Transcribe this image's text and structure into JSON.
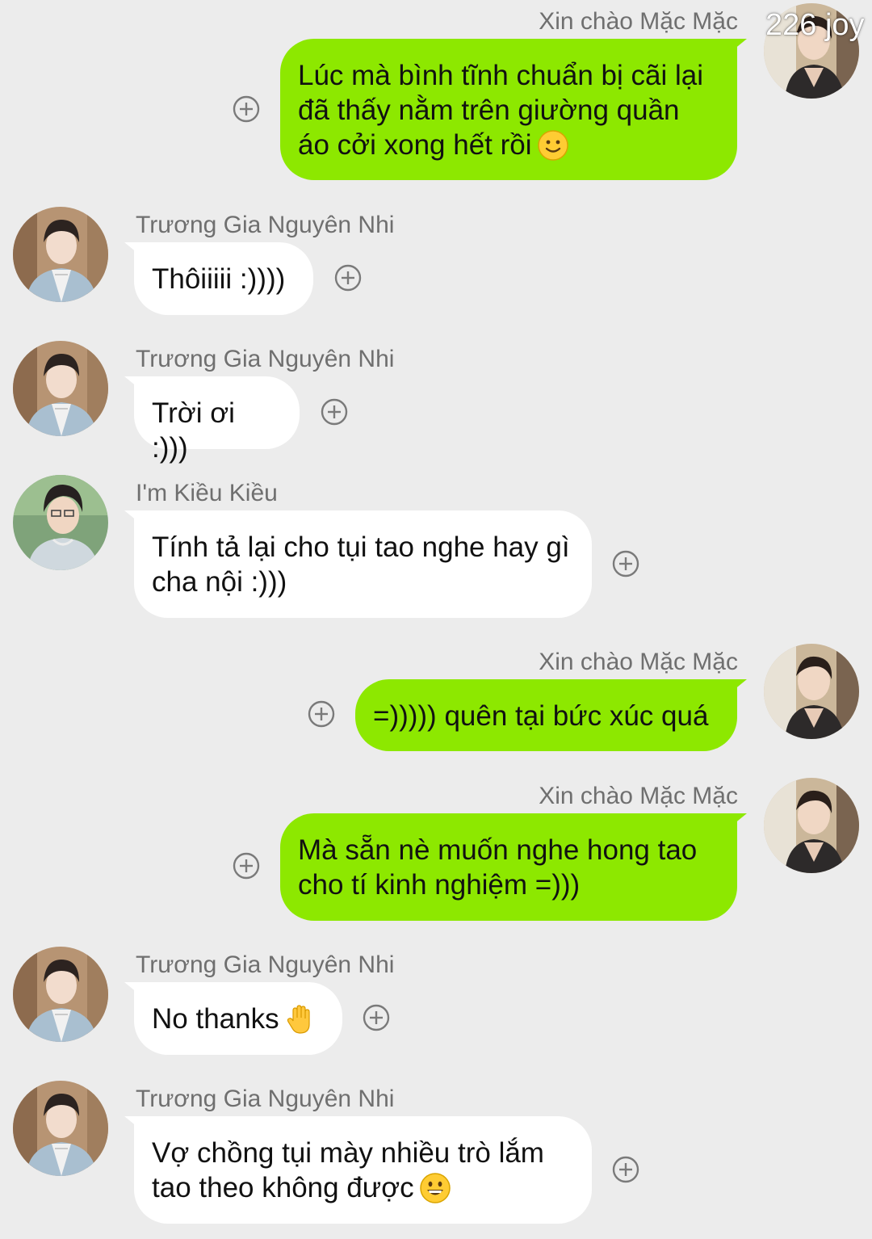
{
  "watermark": "226 joy",
  "messages": [
    {
      "sender": "Xin chào Mặc Mặc",
      "text": "Lúc mà bình tĩnh chuẩn bị cãi lại đã thấy nằm trên giường quần áo cởi xong hết rồi",
      "emoji": "slightly-smiling-face",
      "direction": "out",
      "avatar": "avatar-mac-mac"
    },
    {
      "sender": "Trương Gia Nguyên Nhi",
      "text": "Thôiiiii :))))",
      "direction": "in",
      "avatar": "avatar-nguyen-nhi"
    },
    {
      "sender": "Trương Gia Nguyên Nhi",
      "text": "Trời ơi :)))",
      "direction": "in",
      "avatar": "avatar-nguyen-nhi"
    },
    {
      "sender": "I'm Kiều Kiều",
      "text": "Tính tả lại cho tụi tao nghe hay gì cha nội :)))",
      "direction": "in",
      "avatar": "avatar-kieu-kieu"
    },
    {
      "sender": "Xin chào Mặc Mặc",
      "text": "=))))) quên tại bức xúc quá",
      "direction": "out",
      "avatar": "avatar-mac-mac"
    },
    {
      "sender": "Xin chào Mặc Mặc",
      "text": "Mà sẵn nè muốn nghe hong tao cho tí kinh nghiệm =)))",
      "direction": "out",
      "avatar": "avatar-mac-mac"
    },
    {
      "sender": "Trương Gia Nguyên Nhi",
      "text": "No thanks",
      "emoji": "raised-hand",
      "direction": "in",
      "avatar": "avatar-nguyen-nhi"
    },
    {
      "sender": "Trương Gia Nguyên Nhi",
      "text": "Vợ chồng tụi mày nhiều trò lắm tao theo không được",
      "emoji": "grinning-face",
      "direction": "in",
      "avatar": "avatar-nguyen-nhi"
    }
  ],
  "colors": {
    "background": "#ececec",
    "outgoing_bubble": "#8de800",
    "incoming_bubble": "#ffffff",
    "sender_name": "#6f6f6f"
  },
  "icons": {
    "reaction_button": "plus-circle-icon"
  }
}
